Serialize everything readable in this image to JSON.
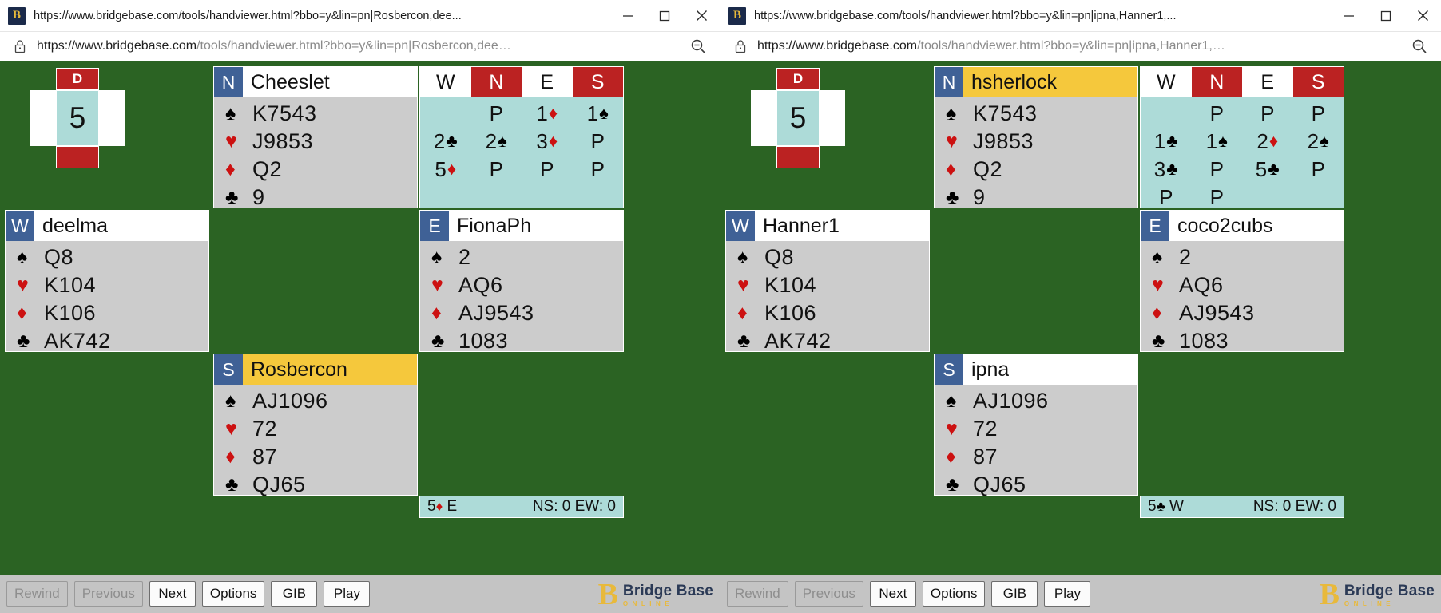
{
  "windows": [
    {
      "titlebar": {
        "favicon_letter": "B",
        "title": "https://www.bridgebase.com/tools/handviewer.html?bbo=y&lin=pn|Rosbercon,dee...",
        "minimize_label": "Minimize",
        "maximize_label": "Maximize",
        "close_label": "Close"
      },
      "address": {
        "url_bold": "https://www.bridgebase.com",
        "url_rest": "/tools/handviewer.html?bbo=y&lin=pn|Rosbercon,dee…",
        "lock_label": "Not secure"
      },
      "dealer": {
        "label": "D",
        "board": "5"
      },
      "hands": {
        "north": {
          "seat": "N",
          "name": "Cheeslet",
          "highlight": false,
          "suits": [
            {
              "symbol": "♠",
              "color": "blk",
              "cards": "K7543"
            },
            {
              "symbol": "♥",
              "color": "red",
              "cards": "J9853"
            },
            {
              "symbol": "♦",
              "color": "red",
              "cards": "Q2"
            },
            {
              "symbol": "♣",
              "color": "blk",
              "cards": "9"
            }
          ]
        },
        "west": {
          "seat": "W",
          "name": "deelma",
          "highlight": false,
          "suits": [
            {
              "symbol": "♠",
              "color": "blk",
              "cards": "Q8"
            },
            {
              "symbol": "♥",
              "color": "red",
              "cards": "K104"
            },
            {
              "symbol": "♦",
              "color": "red",
              "cards": "K106"
            },
            {
              "symbol": "♣",
              "color": "blk",
              "cards": "AK742"
            }
          ]
        },
        "east": {
          "seat": "E",
          "name": "FionaPh",
          "highlight": false,
          "suits": [
            {
              "symbol": "♠",
              "color": "blk",
              "cards": "2"
            },
            {
              "symbol": "♥",
              "color": "red",
              "cards": "AQ6"
            },
            {
              "symbol": "♦",
              "color": "red",
              "cards": "AJ9543"
            },
            {
              "symbol": "♣",
              "color": "blk",
              "cards": "1083"
            }
          ]
        },
        "south": {
          "seat": "S",
          "name": "Rosbercon",
          "highlight": true,
          "suits": [
            {
              "symbol": "♠",
              "color": "blk",
              "cards": "AJ1096"
            },
            {
              "symbol": "♥",
              "color": "red",
              "cards": "72"
            },
            {
              "symbol": "♦",
              "color": "red",
              "cards": "87"
            },
            {
              "symbol": "♣",
              "color": "blk",
              "cards": "QJ65"
            }
          ]
        }
      },
      "auction": {
        "headers": [
          {
            "label": "W",
            "vulnerable": false
          },
          {
            "label": "N",
            "vulnerable": true
          },
          {
            "label": "E",
            "vulnerable": false
          },
          {
            "label": "S",
            "vulnerable": true
          }
        ],
        "rows": [
          [
            {
              "level": "",
              "suit": "",
              "color": ""
            },
            {
              "level": "P",
              "suit": "",
              "color": ""
            },
            {
              "level": "1",
              "suit": "♦",
              "color": "red"
            },
            {
              "level": "1",
              "suit": "♠",
              "color": "blk"
            }
          ],
          [
            {
              "level": "2",
              "suit": "♣",
              "color": "blk"
            },
            {
              "level": "2",
              "suit": "♠",
              "color": "blk"
            },
            {
              "level": "3",
              "suit": "♦",
              "color": "red"
            },
            {
              "level": "P",
              "suit": "",
              "color": ""
            }
          ],
          [
            {
              "level": "5",
              "suit": "♦",
              "color": "red"
            },
            {
              "level": "P",
              "suit": "",
              "color": ""
            },
            {
              "level": "P",
              "suit": "",
              "color": ""
            },
            {
              "level": "P",
              "suit": "",
              "color": ""
            }
          ]
        ]
      },
      "contract": {
        "level": "5",
        "suit": "♦",
        "suit_color": "red",
        "declarer": "E",
        "score": "NS: 0 EW: 0"
      },
      "toolbar": {
        "buttons": [
          {
            "label": "Rewind",
            "disabled": true
          },
          {
            "label": "Previous",
            "disabled": true
          },
          {
            "label": "Next",
            "disabled": false
          },
          {
            "label": "Options",
            "disabled": false
          },
          {
            "label": "GIB",
            "disabled": false
          },
          {
            "label": "Play",
            "disabled": false
          }
        ],
        "logo_mark": "B",
        "logo_main": "Bridge Base",
        "logo_sub": "ONLINE"
      }
    },
    {
      "titlebar": {
        "favicon_letter": "B",
        "title": "https://www.bridgebase.com/tools/handviewer.html?bbo=y&lin=pn|ipna,Hanner1,...",
        "minimize_label": "Minimize",
        "maximize_label": "Maximize",
        "close_label": "Close"
      },
      "address": {
        "url_bold": "https://www.bridgebase.com",
        "url_rest": "/tools/handviewer.html?bbo=y&lin=pn|ipna,Hanner1,…",
        "lock_label": "Not secure"
      },
      "dealer": {
        "label": "D",
        "board": "5"
      },
      "hands": {
        "north": {
          "seat": "N",
          "name": "hsherlock",
          "highlight": true,
          "suits": [
            {
              "symbol": "♠",
              "color": "blk",
              "cards": "K7543"
            },
            {
              "symbol": "♥",
              "color": "red",
              "cards": "J9853"
            },
            {
              "symbol": "♦",
              "color": "red",
              "cards": "Q2"
            },
            {
              "symbol": "♣",
              "color": "blk",
              "cards": "9"
            }
          ]
        },
        "west": {
          "seat": "W",
          "name": "Hanner1",
          "highlight": false,
          "suits": [
            {
              "symbol": "♠",
              "color": "blk",
              "cards": "Q8"
            },
            {
              "symbol": "♥",
              "color": "red",
              "cards": "K104"
            },
            {
              "symbol": "♦",
              "color": "red",
              "cards": "K106"
            },
            {
              "symbol": "♣",
              "color": "blk",
              "cards": "AK742"
            }
          ]
        },
        "east": {
          "seat": "E",
          "name": "coco2cubs",
          "highlight": false,
          "suits": [
            {
              "symbol": "♠",
              "color": "blk",
              "cards": "2"
            },
            {
              "symbol": "♥",
              "color": "red",
              "cards": "AQ6"
            },
            {
              "symbol": "♦",
              "color": "red",
              "cards": "AJ9543"
            },
            {
              "symbol": "♣",
              "color": "blk",
              "cards": "1083"
            }
          ]
        },
        "south": {
          "seat": "S",
          "name": "ipna",
          "highlight": false,
          "suits": [
            {
              "symbol": "♠",
              "color": "blk",
              "cards": "AJ1096"
            },
            {
              "symbol": "♥",
              "color": "red",
              "cards": "72"
            },
            {
              "symbol": "♦",
              "color": "red",
              "cards": "87"
            },
            {
              "symbol": "♣",
              "color": "blk",
              "cards": "QJ65"
            }
          ]
        }
      },
      "auction": {
        "headers": [
          {
            "label": "W",
            "vulnerable": false
          },
          {
            "label": "N",
            "vulnerable": true
          },
          {
            "label": "E",
            "vulnerable": false
          },
          {
            "label": "S",
            "vulnerable": true
          }
        ],
        "rows": [
          [
            {
              "level": "",
              "suit": "",
              "color": ""
            },
            {
              "level": "P",
              "suit": "",
              "color": ""
            },
            {
              "level": "P",
              "suit": "",
              "color": ""
            },
            {
              "level": "P",
              "suit": "",
              "color": ""
            }
          ],
          [
            {
              "level": "1",
              "suit": "♣",
              "color": "blk"
            },
            {
              "level": "1",
              "suit": "♠",
              "color": "blk"
            },
            {
              "level": "2",
              "suit": "♦",
              "color": "red"
            },
            {
              "level": "2",
              "suit": "♠",
              "color": "blk"
            }
          ],
          [
            {
              "level": "3",
              "suit": "♣",
              "color": "blk"
            },
            {
              "level": "P",
              "suit": "",
              "color": ""
            },
            {
              "level": "5",
              "suit": "♣",
              "color": "blk"
            },
            {
              "level": "P",
              "suit": "",
              "color": ""
            }
          ],
          [
            {
              "level": "P",
              "suit": "",
              "color": ""
            },
            {
              "level": "P",
              "suit": "",
              "color": ""
            },
            {
              "level": "",
              "suit": "",
              "color": ""
            },
            {
              "level": "",
              "suit": "",
              "color": ""
            }
          ]
        ]
      },
      "contract": {
        "level": "5",
        "suit": "♣",
        "suit_color": "blk",
        "declarer": "W",
        "score": "NS: 0 EW: 0"
      },
      "toolbar": {
        "buttons": [
          {
            "label": "Rewind",
            "disabled": true
          },
          {
            "label": "Previous",
            "disabled": true
          },
          {
            "label": "Next",
            "disabled": false
          },
          {
            "label": "Options",
            "disabled": false
          },
          {
            "label": "GIB",
            "disabled": false
          },
          {
            "label": "Play",
            "disabled": false
          }
        ],
        "logo_mark": "B",
        "logo_main": "Bridge Base",
        "logo_sub": "ONLINE"
      }
    }
  ]
}
